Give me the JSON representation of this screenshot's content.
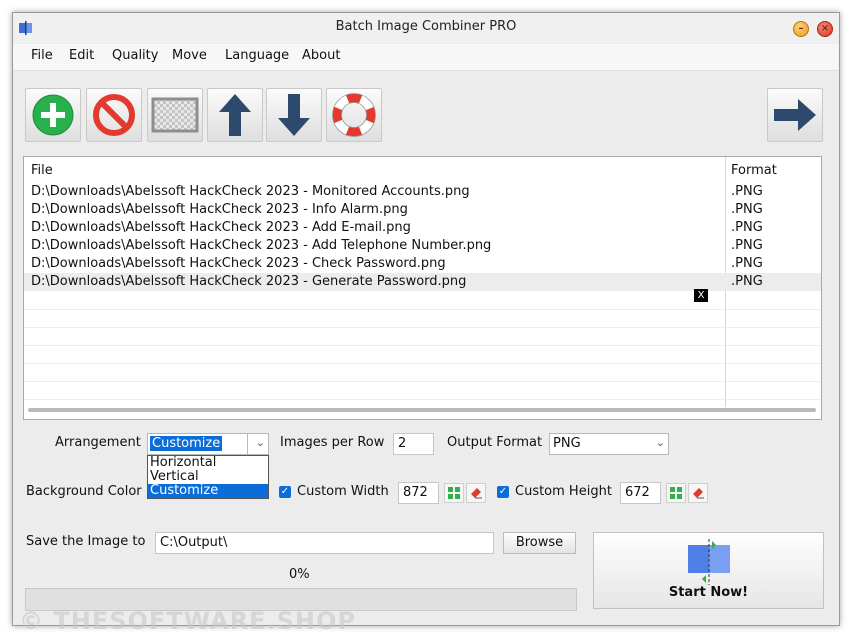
{
  "window": {
    "title": "Batch Image Combiner PRO"
  },
  "menu": [
    "File",
    "Edit",
    "Quality",
    "Move",
    "Language",
    "About"
  ],
  "toolbar": {
    "add": "add-icon",
    "remove": "remove-icon",
    "clear": "clear-icon",
    "up": "arrow-up-icon",
    "down": "arrow-down-icon",
    "help": "lifebuoy-icon",
    "next": "arrow-right-icon"
  },
  "filelist": {
    "headers": {
      "file": "File",
      "format": "Format"
    },
    "rows": [
      {
        "file": "D:\\Downloads\\Abelssoft HackCheck 2023 - Monitored Accounts.png",
        "format": ".PNG"
      },
      {
        "file": "D:\\Downloads\\Abelssoft HackCheck 2023 - Info Alarm.png",
        "format": ".PNG"
      },
      {
        "file": "D:\\Downloads\\Abelssoft HackCheck 2023 - Add E-mail.png",
        "format": ".PNG"
      },
      {
        "file": "D:\\Downloads\\Abelssoft HackCheck 2023 - Add Telephone Number.png",
        "format": ".PNG"
      },
      {
        "file": "D:\\Downloads\\Abelssoft HackCheck 2023 - Check Password.png",
        "format": ".PNG"
      },
      {
        "file": "D:\\Downloads\\Abelssoft HackCheck 2023 - Generate Password.png",
        "format": ".PNG"
      }
    ],
    "badge": "X"
  },
  "settings": {
    "arrangement_label": "Arrangement",
    "arrangement_value": "Customize",
    "arrangement_options": [
      "Horizontal",
      "Vertical",
      "Customize"
    ],
    "images_per_row_label": "Images per Row",
    "images_per_row_value": "2",
    "output_format_label": "Output Format",
    "output_format_value": "PNG",
    "bg_color_label": "Background Color",
    "custom_width_label": "Custom Width",
    "custom_width_value": "872",
    "custom_height_label": "Custom Height",
    "custom_height_value": "672",
    "save_label": "Save the Image to",
    "save_path": "C:\\Output\\",
    "browse_label": "Browse"
  },
  "progress": {
    "percent_text": "0%",
    "fraction": 0
  },
  "start_label": "Start Now!",
  "watermark": "© THESOFTWARE.SHOP"
}
